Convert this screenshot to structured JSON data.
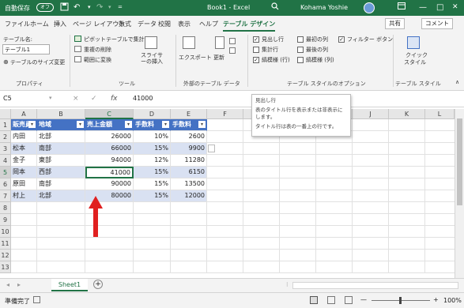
{
  "titlebar": {
    "autosave_label": "自動保存",
    "autosave_state": "オフ",
    "title": "Book1 - Excel",
    "user": "Kohama Yoshie",
    "icons": [
      "save-icon",
      "undo-icon",
      "redo-icon",
      "search-icon",
      "ribbon-display-icon",
      "minimize-icon",
      "maximize-icon",
      "close-icon"
    ],
    "minimize": "—",
    "maximize": "□",
    "close": "✕"
  },
  "menu": {
    "items": [
      "ファイル",
      "ホーム",
      "挿入",
      "ページ レイアウト",
      "数式",
      "データ",
      "校閲",
      "表示",
      "ヘルプ",
      "テーブル デザイン"
    ],
    "active": "テーブル デザイン",
    "share": "共有",
    "comment": "コメント"
  },
  "ribbon": {
    "props": {
      "table_name_label": "テーブル名:",
      "table_name": "テーブル1",
      "resize": "テーブルのサイズ変更",
      "group": "プロパティ"
    },
    "tools": {
      "pivot": "ピボットテーブルで集計",
      "remove_dup": "重複の削除",
      "convert": "範囲に変換",
      "slicer": "スライサーの挿入",
      "group": "ツール"
    },
    "external": {
      "export": "エクスポート",
      "refresh": "更新",
      "group": "外部のテーブル データ"
    },
    "style_options": {
      "header_row": "見出し行",
      "total_row": "集計行",
      "banded_rows": "縞模様 (行)",
      "first_col": "最初の列",
      "last_col": "最後の列",
      "banded_cols": "縞模様 (列)",
      "filter_btn": "フィルター ボタン",
      "group": "テーブル スタイルのオプション"
    },
    "styles": {
      "quick": "クイック",
      "quick2": "スタイル",
      "group": "テーブル スタイル"
    }
  },
  "formula": {
    "cellref": "C5",
    "value": "41000",
    "fx": "fx",
    "cancel": "×",
    "enter": "✓"
  },
  "tooltip": {
    "title": "見出し行",
    "line1": "表のタイトル行を表示または非表示にします。",
    "line2": "タイトル行は表の一番上の行です。"
  },
  "grid": {
    "columns": [
      "A",
      "B",
      "C",
      "D",
      "E",
      "F",
      "G",
      "H",
      "I",
      "J",
      "K",
      "L"
    ],
    "rows": [
      "1",
      "2",
      "3",
      "4",
      "5",
      "6",
      "7",
      "8",
      "9",
      "10",
      "11",
      "12",
      "13"
    ],
    "headers": [
      "販売員",
      "地域",
      "売上金額",
      "手数料",
      "手数料"
    ],
    "data": [
      [
        "内田",
        "北部",
        "26000",
        "10%",
        "2600"
      ],
      [
        "松本",
        "南部",
        "66000",
        "15%",
        "9900"
      ],
      [
        "金子",
        "東部",
        "94000",
        "12%",
        "11280"
      ],
      [
        "岡本",
        "西部",
        "41000",
        "15%",
        "6150"
      ],
      [
        "原田",
        "南部",
        "90000",
        "15%",
        "13500"
      ],
      [
        "村上",
        "北部",
        "80000",
        "15%",
        "12000"
      ]
    ]
  },
  "sheet": {
    "tab": "Sheet1",
    "add": "+"
  },
  "status": {
    "ready": "準備完了",
    "zoom": "100%",
    "zoom_out": "—",
    "zoom_in": "+"
  },
  "colors": {
    "accent": "#217346",
    "table_header": "#4472c4",
    "band": "#d9e1f2",
    "arrow": "#e02020"
  }
}
